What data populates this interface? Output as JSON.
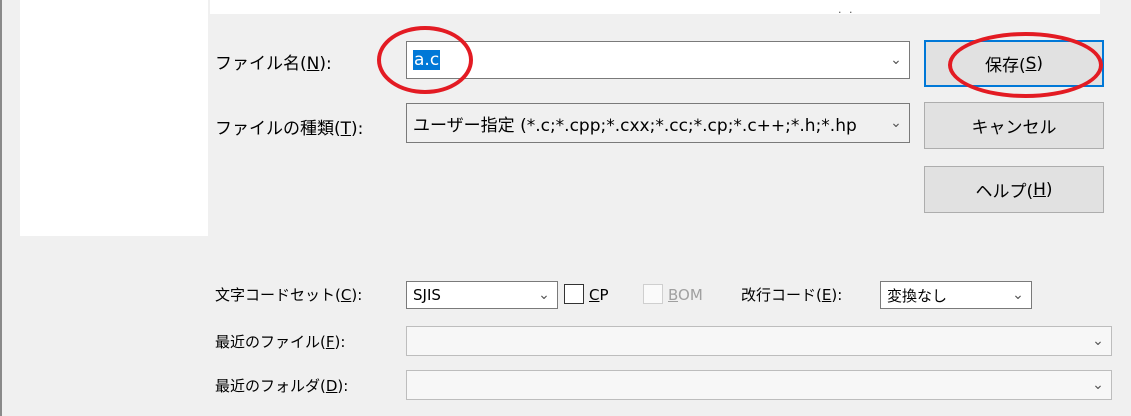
{
  "top": {
    "dots": "· ·"
  },
  "filename": {
    "label_prefix": "ファイル名(",
    "label_key": "N",
    "label_suffix": "):",
    "value": "a.c"
  },
  "filetype": {
    "label_prefix": "ファイルの種類(",
    "label_key": "T",
    "label_suffix": "):",
    "value": "ユーザー指定 (*.c;*.cpp;*.cxx;*.cc;*.cp;*.c++;*.h;*.hp"
  },
  "buttons": {
    "save_prefix": "保存(",
    "save_key": "S",
    "save_suffix": ")",
    "cancel": "キャンセル",
    "help_prefix": "ヘルプ(",
    "help_key": "H",
    "help_suffix": ")"
  },
  "charset": {
    "label_prefix": "文字コードセット(",
    "label_key": "C",
    "label_suffix": "):",
    "value": "SJIS"
  },
  "cp": {
    "key": "C",
    "rest": "P",
    "checked": false
  },
  "bom": {
    "key": "B",
    "rest": "OM",
    "checked": false,
    "enabled": false
  },
  "newline": {
    "label_prefix": "改行コード(",
    "label_key": "E",
    "label_suffix": "):",
    "value": "変換なし"
  },
  "recent_file": {
    "label_prefix": "最近のファイル(",
    "label_key": "F",
    "label_suffix": "):",
    "value": ""
  },
  "recent_folder": {
    "label_prefix": "最近のフォルダ(",
    "label_key": "D",
    "label_suffix": "):",
    "value": ""
  },
  "icons": {
    "chevron": "chevron-down-icon"
  },
  "colors": {
    "annotation": "#e31b23",
    "selection": "#0078d7"
  }
}
